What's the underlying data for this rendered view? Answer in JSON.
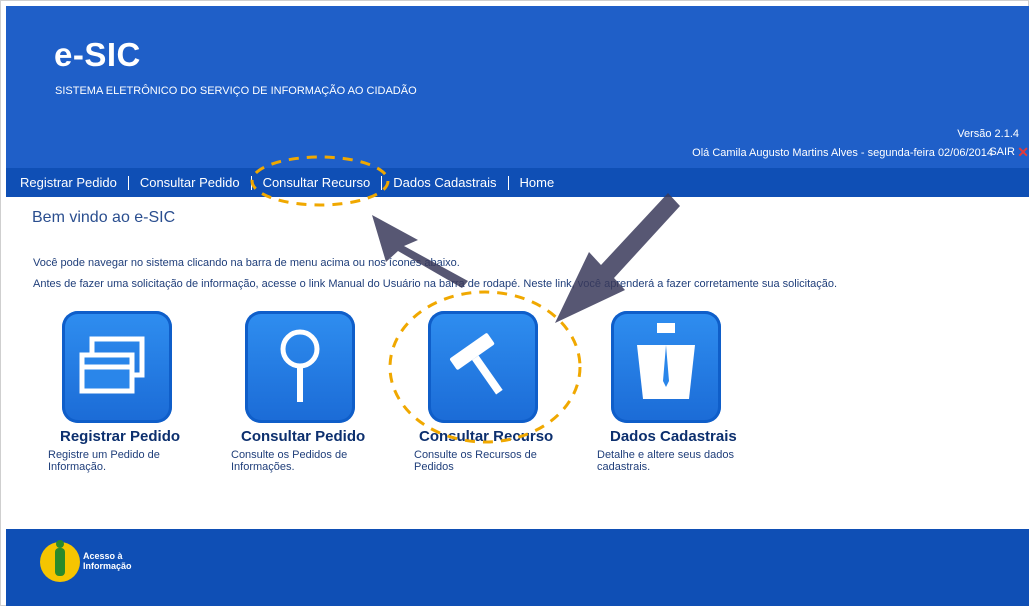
{
  "header": {
    "logo": "e-SIC",
    "subtitle": "SISTEMA ELETRÔNICO DO SERVIÇO DE INFORMAÇÃO AO CIDADÃO",
    "version": "Versão 2.1.4",
    "greeting": "Olá Camila Augusto Martins Alves - segunda-feira 02/06/2014",
    "logout_label": "SAIR"
  },
  "menu": {
    "items": [
      {
        "label": "Registrar Pedido"
      },
      {
        "label": "Consultar Pedido"
      },
      {
        "label": "Consultar Recurso"
      },
      {
        "label": "Dados Cadastrais"
      },
      {
        "label": "Home"
      }
    ]
  },
  "main": {
    "welcome": "Bem vindo ao e-SIC",
    "info1": "Você pode navegar no sistema clicando na barra de menu acima ou nos ícones abaixo.",
    "info2": "Antes de fazer uma solicitação de informação, acesse o link Manual do Usuário na barra de rodapé. Neste link, você aprenderá a fazer corretamente sua solicitação.",
    "cards": [
      {
        "title": "Registrar Pedido",
        "desc": "Registre um Pedido de Informação.",
        "icon": "windows-icon"
      },
      {
        "title": "Consultar Pedido",
        "desc": "Consulte os Pedidos de Informações.",
        "icon": "magnifier-icon"
      },
      {
        "title": "Consultar Recurso",
        "desc": "Consulte os Recursos de Pedidos",
        "icon": "gavel-icon"
      },
      {
        "title": "Dados Cadastrais",
        "desc": "Detalhe e altere seus dados cadastrais.",
        "icon": "person-suit-icon"
      }
    ]
  },
  "footer": {
    "badge_text_line1": "Acesso à",
    "badge_text_line2": "Informação"
  },
  "colors": {
    "header_blue": "#1f5fc8",
    "menubar_blue": "#0f4fb5",
    "annotation_orange": "#f0a800",
    "annotation_arrow": "#3a3a5a"
  }
}
